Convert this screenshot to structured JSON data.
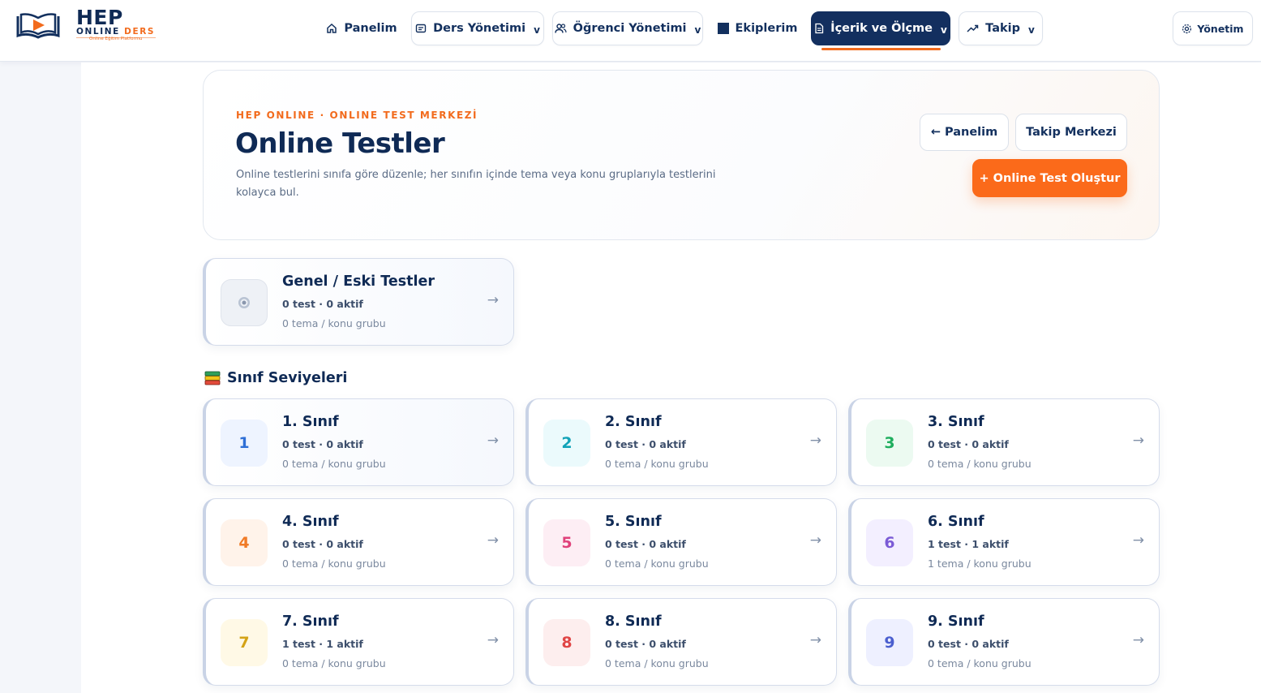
{
  "brand": {
    "name": "HEP",
    "line": "ONLINE",
    "accent": "DERS",
    "tagline": "Online Eğitim Platformu"
  },
  "nav": {
    "panelim": "Panelim",
    "ders": "Ders Yönetimi",
    "ogrenci": "Öğrenci Yönetimi",
    "ekip": "Ekiplerim",
    "icerik": "İçerik ve Ölçme",
    "takip": "Takip",
    "yonetim": "Yönetim",
    "chevron": "v"
  },
  "hero": {
    "eyebrow": "HEP ONLINE · ONLINE TEST MERKEZİ",
    "title": "Online Testler",
    "description": "Online testlerini sınıfa göre düzenle; her sınıfın içinde tema veya konu gruplarıyla testlerini kolayca bul.",
    "btn_back": "← Panelim",
    "btn_track": "Takip Merkezi",
    "btn_create": "+ Online Test Oluştur"
  },
  "general_card": {
    "title": "Genel / Eski Testler",
    "stat": "0 test · 0 aktif",
    "group": "0 tema / konu grubu",
    "arrow": "→"
  },
  "section": {
    "title": "Sınıf Seviyeleri"
  },
  "grades": [
    {
      "num": "1",
      "title": "1. Sınıf",
      "stat": "0 test · 0 aktif",
      "group": "0 tema / konu grubu",
      "arrow": "→",
      "color": "#2f6fd6",
      "bg": "#eef4ff"
    },
    {
      "num": "2",
      "title": "2. Sınıf",
      "stat": "0 test · 0 aktif",
      "group": "0 tema / konu grubu",
      "arrow": "→",
      "color": "#13a3b8",
      "bg": "#ebfafc"
    },
    {
      "num": "3",
      "title": "3. Sınıf",
      "stat": "0 test · 0 aktif",
      "group": "0 tema / konu grubu",
      "arrow": "→",
      "color": "#1fae5e",
      "bg": "#ecfaf1"
    },
    {
      "num": "4",
      "title": "4. Sınıf",
      "stat": "0 test · 0 aktif",
      "group": "0 tema / konu grubu",
      "arrow": "→",
      "color": "#f07a26",
      "bg": "#fff3ea"
    },
    {
      "num": "5",
      "title": "5. Sınıf",
      "stat": "0 test · 0 aktif",
      "group": "0 tema / konu grubu",
      "arrow": "→",
      "color": "#e0417a",
      "bg": "#fdeef4"
    },
    {
      "num": "6",
      "title": "6. Sınıf",
      "stat": "1 test · 1 aktif",
      "group": "1 tema / konu grubu",
      "arrow": "→",
      "color": "#7b5bd6",
      "bg": "#f3efff"
    },
    {
      "num": "7",
      "title": "7. Sınıf",
      "stat": "1 test · 1 aktif",
      "group": "0 tema / konu grubu",
      "arrow": "→",
      "color": "#d4a316",
      "bg": "#fff9e6"
    },
    {
      "num": "8",
      "title": "8. Sınıf",
      "stat": "0 test · 0 aktif",
      "group": "0 tema / konu grubu",
      "arrow": "→",
      "color": "#e04545",
      "bg": "#fdeeee"
    },
    {
      "num": "9",
      "title": "9. Sınıf",
      "stat": "0 test · 0 aktif",
      "group": "0 tema / konu grubu",
      "arrow": "→",
      "color": "#4b5fcf",
      "bg": "#eef0ff"
    }
  ],
  "colors": {
    "navy": "#0f2a55",
    "accent": "#fb6a1a",
    "active_nav": "#132f5f"
  }
}
